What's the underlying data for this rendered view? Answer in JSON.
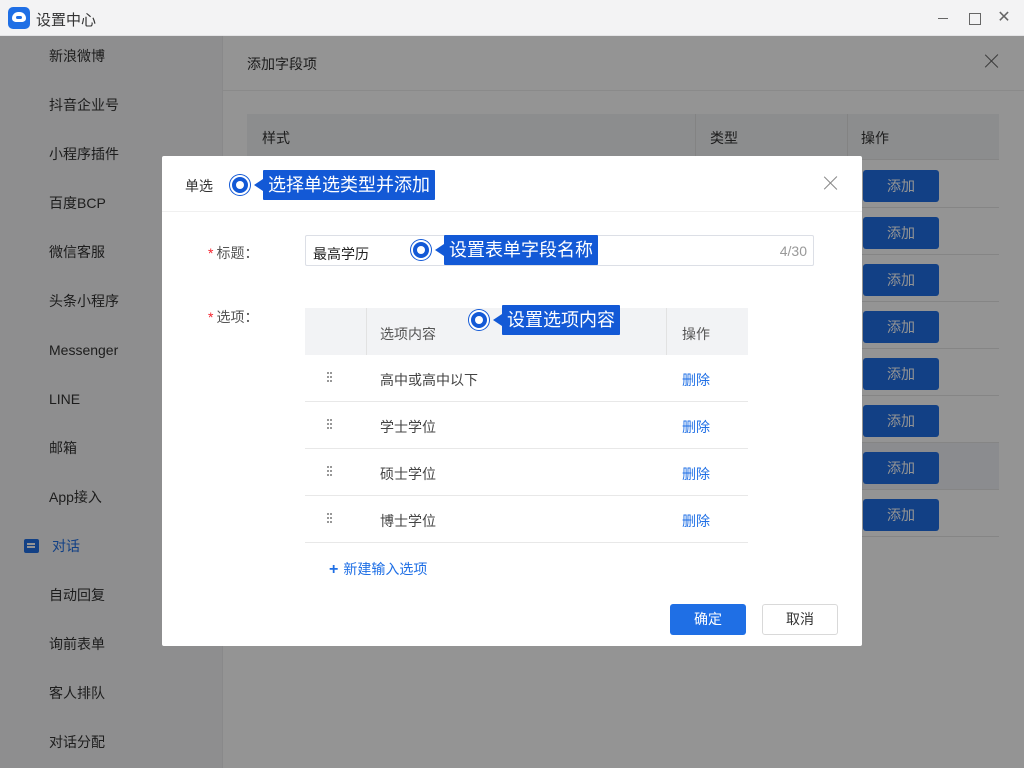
{
  "window": {
    "title": "设置中心"
  },
  "sidebar": {
    "items": [
      {
        "label": "新浪微博"
      },
      {
        "label": "抖音企业号"
      },
      {
        "label": "小程序插件"
      },
      {
        "label": "百度BCP"
      },
      {
        "label": "微信客服"
      },
      {
        "label": "头条小程序"
      },
      {
        "label": "Messenger"
      },
      {
        "label": "LINE"
      },
      {
        "label": "邮箱"
      },
      {
        "label": "App接入"
      },
      {
        "label": "对话",
        "active": true,
        "icon": "chat-icon"
      },
      {
        "label": "自动回复"
      },
      {
        "label": "询前表单"
      },
      {
        "label": "客人排队"
      },
      {
        "label": "对话分配"
      }
    ]
  },
  "drawer": {
    "title": "添加字段项",
    "table": {
      "headers": [
        "样式",
        "类型",
        "操作"
      ],
      "add_label": "添加",
      "row_count": 8
    }
  },
  "modal": {
    "title": "单选",
    "title_field": {
      "label": "标题：",
      "value": "最高学历",
      "counter": "4/30"
    },
    "options_field": {
      "label": "选项："
    },
    "options_table": {
      "headers": [
        "选项内容",
        "操作"
      ],
      "rows": [
        {
          "text": "高中或高中以下",
          "action": "删除"
        },
        {
          "text": "学士学位",
          "action": "删除"
        },
        {
          "text": "硕士学位",
          "action": "删除"
        },
        {
          "text": "博士学位",
          "action": "删除"
        }
      ]
    },
    "new_option_label": "新建输入选项",
    "confirm_label": "确定",
    "cancel_label": "取消"
  },
  "annotations": [
    {
      "text": "选择单选类型并添加"
    },
    {
      "text": "设置表单字段名称"
    },
    {
      "text": "设置选项内容"
    }
  ],
  "colors": {
    "accent": "#1f6fe5",
    "annotation": "#1359d6",
    "required": "#f5222d"
  }
}
